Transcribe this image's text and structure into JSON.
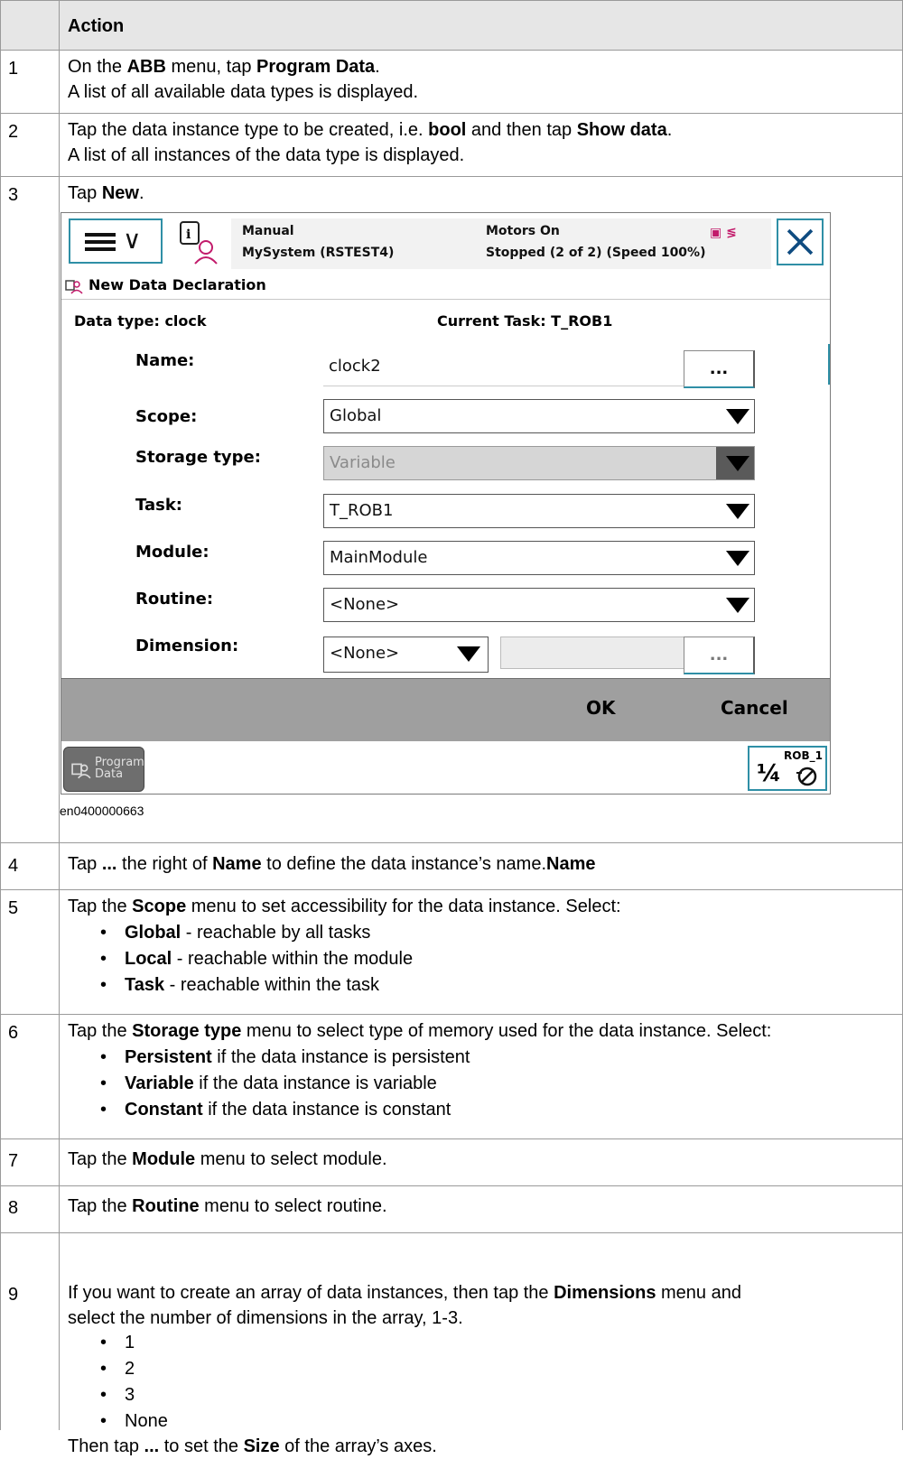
{
  "header": {
    "action": "Action"
  },
  "steps": [
    {
      "num": "1",
      "lines": [
        [
          [
            "On the ",
            false
          ],
          [
            "ABB",
            true
          ],
          [
            " menu, tap ",
            false
          ],
          [
            "Program Data",
            true
          ],
          [
            ".",
            false
          ]
        ],
        [
          [
            "A list of all available data types is displayed.",
            false
          ]
        ]
      ]
    },
    {
      "num": "2",
      "lines": [
        [
          [
            "Tap the data instance type to be created, i.e. ",
            false
          ],
          [
            "bool",
            true
          ],
          [
            " and then tap ",
            false
          ],
          [
            "Show data",
            true
          ],
          [
            ".",
            false
          ]
        ],
        [
          [
            "A list of all instances of the data type is displayed.",
            false
          ]
        ]
      ]
    },
    {
      "num": "3",
      "lines": [
        [
          [
            "Tap ",
            false
          ],
          [
            "New",
            true
          ],
          [
            ".",
            false
          ]
        ]
      ]
    },
    {
      "num": "4",
      "lines": [
        [
          [
            "Tap ",
            false
          ],
          [
            "...",
            true
          ],
          [
            " the right of ",
            false
          ],
          [
            "Name",
            true
          ],
          [
            " to define the data instance’s name.",
            false
          ],
          [
            "Name",
            true
          ]
        ]
      ]
    },
    {
      "num": "5",
      "lines": [
        [
          [
            "Tap the ",
            false
          ],
          [
            "Scope",
            true
          ],
          [
            " menu to set accessibility for the data instance. Select:",
            false
          ]
        ]
      ],
      "bullets": [
        [
          [
            "Global",
            true
          ],
          [
            " - reachable by all tasks",
            false
          ]
        ],
        [
          [
            "Local",
            true
          ],
          [
            " - reachable within the module",
            false
          ]
        ],
        [
          [
            "Task",
            true
          ],
          [
            " - reachable within the task",
            false
          ]
        ]
      ]
    },
    {
      "num": "6",
      "lines": [
        [
          [
            "Tap the ",
            false
          ],
          [
            "Storage type",
            true
          ],
          [
            " menu to select type of memory used for the data instance. Select:",
            false
          ]
        ]
      ],
      "bullets": [
        [
          [
            "Persistent",
            true
          ],
          [
            " if the data instance is persistent",
            false
          ]
        ],
        [
          [
            "Variable",
            true
          ],
          [
            " if the data instance is variable",
            false
          ]
        ],
        [
          [
            "Constant",
            true
          ],
          [
            " if the data instance is constant",
            false
          ]
        ]
      ]
    },
    {
      "num": "7",
      "lines": [
        [
          [
            "Tap the ",
            false
          ],
          [
            "Module",
            true
          ],
          [
            " menu to select module.",
            false
          ]
        ]
      ]
    },
    {
      "num": "8",
      "lines": [
        [
          [
            "Tap the ",
            false
          ],
          [
            "Routine",
            true
          ],
          [
            " menu to select routine.",
            false
          ]
        ]
      ]
    },
    {
      "num": "9",
      "lines": [
        [
          [
            "If you want to create an array of data instances, then tap the ",
            false
          ],
          [
            "Dimensions",
            true
          ],
          [
            " menu and",
            false
          ]
        ],
        [
          [
            "select the number of dimensions in the array, 1-3.",
            false
          ]
        ]
      ],
      "bullets": [
        [
          [
            "1",
            false
          ]
        ],
        [
          [
            "2",
            false
          ]
        ],
        [
          [
            "3",
            false
          ]
        ],
        [
          [
            "None",
            false
          ]
        ]
      ],
      "after": [
        [
          [
            "Then tap ",
            false
          ],
          [
            "...",
            true
          ],
          [
            " to set the ",
            false
          ],
          [
            "Size",
            true
          ],
          [
            " of the array’s axes.",
            false
          ]
        ]
      ]
    }
  ],
  "screen": {
    "mode": "Manual",
    "system": "MySystem (RSTEST4)",
    "motors": "Motors On",
    "state": "Stopped (2 of 2) (Speed 100%)",
    "title": "New Data Declaration",
    "data_type": "Data type: clock",
    "current_task": "Current Task:  T_ROB1",
    "fields": {
      "name_label": "Name:",
      "name_value": "clock2",
      "scope_label": "Scope:",
      "scope_value": "Global",
      "storage_label": "Storage type:",
      "storage_value": "Variable",
      "task_label": "Task:",
      "task_value": "T_ROB1",
      "module_label": "Module:",
      "module_value": "MainModule",
      "routine_label": "Routine:",
      "routine_value": "<None>",
      "dimension_label": "Dimension:",
      "dimension_value": "<None>"
    },
    "dots": "...",
    "ok": "OK",
    "cancel": "Cancel",
    "taskbar_line1": "Program",
    "taskbar_line2": "Data",
    "rob": "ROB_1",
    "rob_fraction": "¼",
    "icons": [
      "menu-icon",
      "info-icon",
      "close-icon",
      "person-icon",
      "robot-icon"
    ]
  },
  "caption": "en0400000663"
}
